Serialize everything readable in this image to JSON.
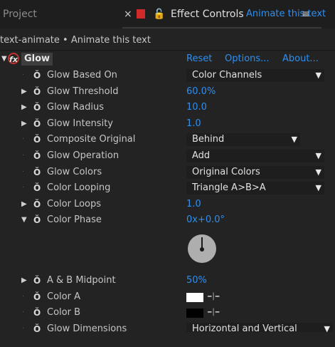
{
  "tabs": {
    "project": "Project",
    "close_glyph": "×",
    "color_label": "#d02a2a",
    "lock_glyph": "🔓",
    "title": "Effect Controls",
    "subtitle": "Animate this text",
    "menu_glyph": "≡"
  },
  "breadcrumb": "text-animate • Animate this text",
  "effect": {
    "name": "Glow",
    "fx_glyph": "fx",
    "reset": "Reset",
    "options": "Options...",
    "about": "About..."
  },
  "props": [
    {
      "label": "Glow Based On",
      "dropdown": "Color Channels",
      "has_twirl": false
    },
    {
      "label": "Glow Threshold",
      "value": "60.0%",
      "has_twirl": true
    },
    {
      "label": "Glow Radius",
      "value": "10.0",
      "has_twirl": true
    },
    {
      "label": "Glow Intensity",
      "value": "1.0",
      "has_twirl": true
    },
    {
      "label": "Composite Original",
      "dropdown": "Behind",
      "has_twirl": false
    },
    {
      "label": "Glow Operation",
      "dropdown": "Add",
      "has_twirl": false
    },
    {
      "label": "Glow Colors",
      "dropdown": "Original Colors",
      "has_twirl": false
    },
    {
      "label": "Color Looping",
      "dropdown": "Triangle A>B>A",
      "has_twirl": false
    },
    {
      "label": "Color Loops",
      "value": "1.0",
      "has_twirl": true
    },
    {
      "label": "Color Phase",
      "value": "0x+0.0°",
      "has_twirl": true,
      "expanded": true
    },
    {
      "label": "A & B Midpoint",
      "value": "50%",
      "has_twirl": true
    },
    {
      "label": "Color A",
      "swatch": "#ffffff",
      "has_twirl": false
    },
    {
      "label": "Color B",
      "swatch": "#000000",
      "has_twirl": false
    },
    {
      "label": "Glow Dimensions",
      "dropdown": "Horizontal and Vertical",
      "has_twirl": false
    }
  ],
  "icons": {
    "watch": "stopwatch-icon",
    "eyedropper": "eyedropper-icon",
    "dropdown": "chevron-down-icon",
    "twirl_closed": "triangle-right-icon",
    "twirl_open": "triangle-down-icon"
  },
  "glyphs": {
    "watch": "Ŏ",
    "eyedropper": "⊸",
    "arrow": "▼",
    "twirl_closed": "▶",
    "twirl_open": "▼",
    "dot": "·"
  }
}
